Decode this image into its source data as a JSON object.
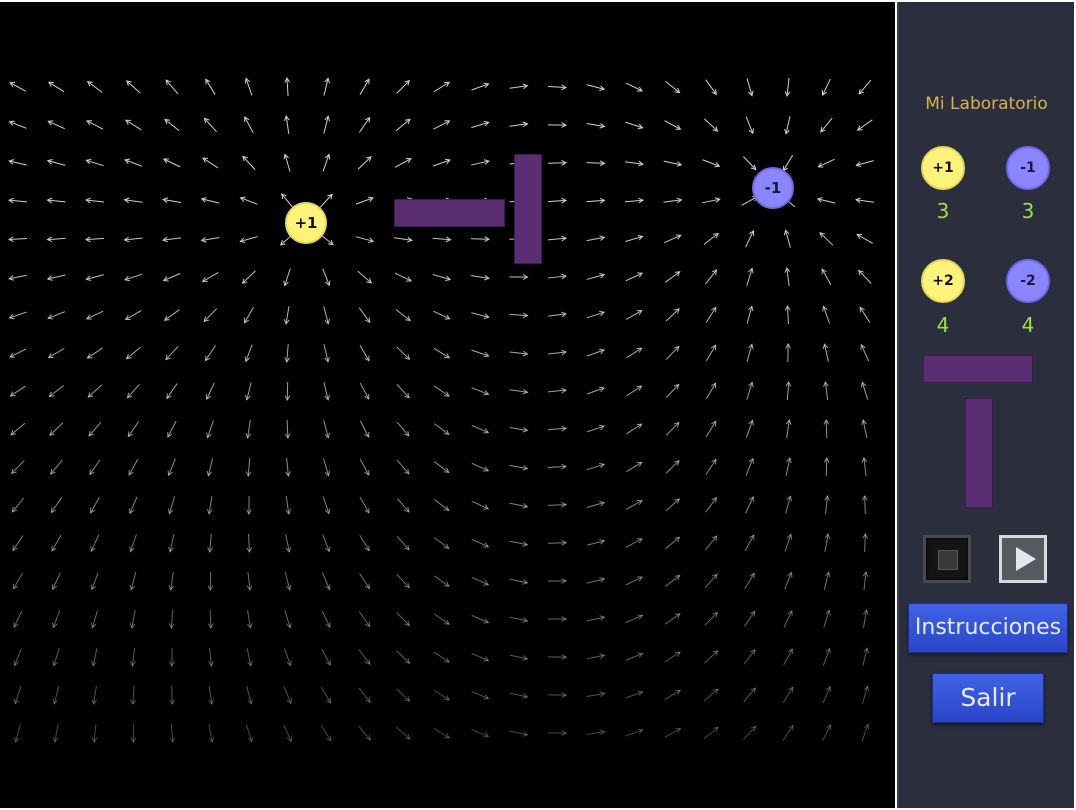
{
  "field": {
    "charges": [
      {
        "label": "+1",
        "sign": "positive"
      },
      {
        "label": "-1",
        "sign": "negative"
      }
    ],
    "walls": [
      "horizontal",
      "vertical"
    ],
    "arrow_color": "#d0d0d0"
  },
  "panel": {
    "title": "Mi Laboratorio",
    "palette": [
      {
        "label": "+1",
        "count": "3",
        "sign": "positive"
      },
      {
        "label": "-1",
        "count": "3",
        "sign": "negative"
      },
      {
        "label": "+2",
        "count": "4",
        "sign": "positive"
      },
      {
        "label": "-2",
        "count": "4",
        "sign": "negative"
      }
    ],
    "buttons": {
      "stop": "stop-icon",
      "play": "play-icon",
      "instructions": "Instrucciones",
      "exit": "Salir"
    }
  },
  "colors": {
    "positive": "#fdf37b",
    "negative": "#8a86ff",
    "wall": "#5b2e73",
    "panel": "#2b2e3c",
    "title": "#d7b24a",
    "count": "#9be14a",
    "button": "#3452d9"
  }
}
